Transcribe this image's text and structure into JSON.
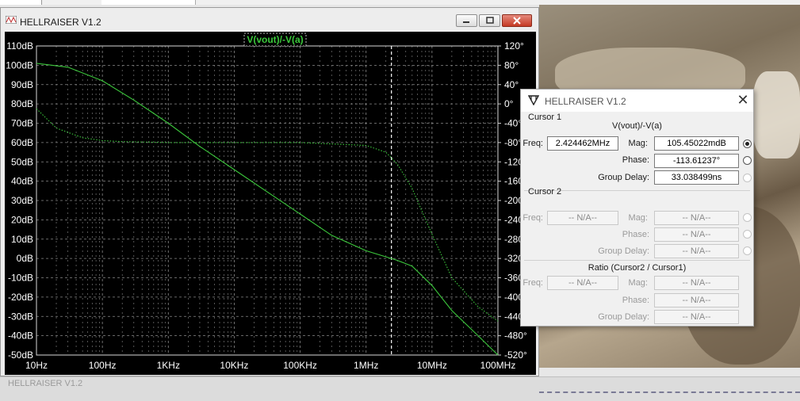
{
  "plot_window": {
    "title": "HELLRAISER V1.2",
    "trace_label": "V(vout)/-V(a)",
    "buttons": [
      "minimize",
      "maximize",
      "close"
    ]
  },
  "chart_data": {
    "type": "line",
    "title": "V(vout)/-V(a)",
    "x_scale": "log",
    "xlim": [
      10,
      100000000
    ],
    "x_ticks": [
      "10Hz",
      "100Hz",
      "1KHz",
      "10KHz",
      "100KHz",
      "1MHz",
      "10MHz",
      "100MHz"
    ],
    "y_left_ticks": [
      "110dB",
      "100dB",
      "90dB",
      "80dB",
      "70dB",
      "60dB",
      "50dB",
      "40dB",
      "30dB",
      "20dB",
      "10dB",
      "0dB",
      "-10dB",
      "-20dB",
      "-30dB",
      "-40dB",
      "-50dB"
    ],
    "ylim_left": [
      -50,
      110
    ],
    "y_right_ticks": [
      "120°",
      "80°",
      "40°",
      "0°",
      "-40°",
      "-80°",
      "-120°",
      "-160°",
      "-200°",
      "-240°",
      "-280°",
      "-320°",
      "-360°",
      "-400°",
      "-440°",
      "-480°",
      "-520°"
    ],
    "ylim_right": [
      -520,
      120
    ],
    "grid": true,
    "cursor_x": 2424462,
    "series": [
      {
        "name": "Magnitude",
        "style": "solid",
        "color": "#3cc83c",
        "axis": "left",
        "x": [
          10,
          30,
          100,
          300,
          1000,
          3000,
          10000,
          30000,
          100000,
          300000,
          1000000,
          2400000,
          3000000,
          5000000,
          10000000,
          20000000,
          50000000,
          100000000
        ],
        "y": [
          101,
          99,
          92,
          82,
          70,
          58,
          46,
          35,
          23,
          12,
          4,
          0,
          -1,
          -4,
          -14,
          -27,
          -40,
          -50
        ]
      },
      {
        "name": "Phase",
        "style": "dotted",
        "color": "#3cc83c",
        "axis": "right",
        "x": [
          10,
          20,
          50,
          100,
          200,
          500,
          1000,
          10000,
          100000,
          1000000,
          2000000,
          3000000,
          5000000,
          10000000,
          20000000,
          50000000,
          100000000
        ],
        "y": [
          -10,
          -50,
          -70,
          -76,
          -78,
          -79,
          -80,
          -80,
          -80,
          -86,
          -100,
          -125,
          -175,
          -270,
          -360,
          -420,
          -450
        ]
      }
    ]
  },
  "dialog": {
    "title": "HELLRAISER V1.2",
    "cursor1": {
      "header": "Cursor 1",
      "trace": "V(vout)/-V(a)",
      "freq_label": "Freq:",
      "freq": "2.424462MHz",
      "mag_label": "Mag:",
      "mag": "105.45022mdB",
      "phase_label": "Phase:",
      "phase": "-113.61237°",
      "gd_label": "Group Delay:",
      "gd": "33.038499ns"
    },
    "cursor2": {
      "header": "Cursor 2",
      "freq_label": "Freq:",
      "freq": "-- N/A--",
      "mag_label": "Mag:",
      "mag": "-- N/A--",
      "phase_label": "Phase:",
      "phase": "-- N/A--",
      "gd_label": "Group Delay:",
      "gd": "-- N/A--"
    },
    "ratio": {
      "header": "Ratio (Cursor2 / Cursor1)",
      "freq_label": "Freq:",
      "freq": "-- N/A--",
      "mag_label": "Mag:",
      "mag": "-- N/A--",
      "phase_label": "Phase:",
      "phase": "-- N/A--",
      "gd_label": "Group Delay:",
      "gd": "-- N/A--"
    }
  },
  "background": {
    "bottom_window_title": "HELLRAISER V1.2"
  }
}
